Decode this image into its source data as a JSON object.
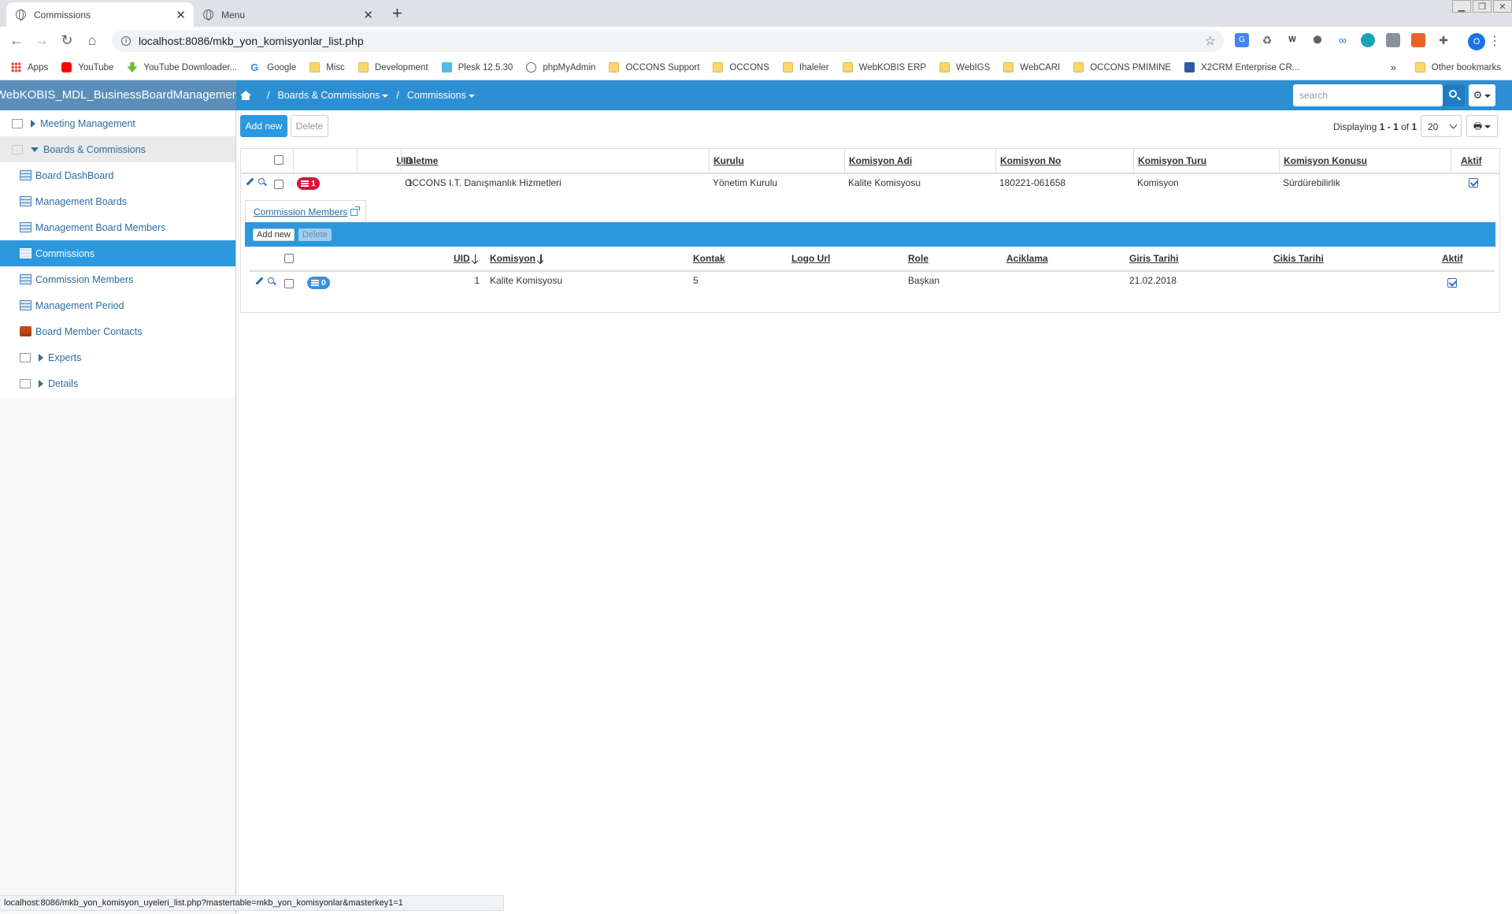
{
  "browser": {
    "tabs": [
      {
        "title": "Commissions",
        "active": true
      },
      {
        "title": "Menu",
        "active": false
      }
    ],
    "url": "localhost:8086/mkb_yon_komisyonlar_list.php",
    "bookmarks": [
      {
        "label": "Apps",
        "icon": "apps-icon"
      },
      {
        "label": "YouTube",
        "icon": "youtube-icon"
      },
      {
        "label": "YouTube Downloader...",
        "icon": "download-icon"
      },
      {
        "label": "Google",
        "icon": "google-icon"
      },
      {
        "label": "Misc",
        "icon": "folder-icon"
      },
      {
        "label": "Development",
        "icon": "folder-icon"
      },
      {
        "label": "Plesk 12.5.30",
        "icon": "plesk-icon"
      },
      {
        "label": "phpMyAdmin",
        "icon": "globe-icon"
      },
      {
        "label": "OCCONS Support",
        "icon": "folder-icon"
      },
      {
        "label": "OCCONS",
        "icon": "folder-icon"
      },
      {
        "label": "Ihaleler",
        "icon": "folder-icon"
      },
      {
        "label": "WebKOBIS ERP",
        "icon": "folder-icon"
      },
      {
        "label": "WebIGS",
        "icon": "folder-icon"
      },
      {
        "label": "WebCARI",
        "icon": "folder-icon"
      },
      {
        "label": "OCCONS PMIMINE",
        "icon": "folder-icon"
      },
      {
        "label": "X2CRM Enterprise CR...",
        "icon": "x2crm-icon"
      }
    ],
    "more_bookmarks": "»",
    "other_bookmarks": "Other bookmarks",
    "profile_initial": "O",
    "status_url": "localhost:8086/mkb_yon_komisyon_uyeleri_list.php?mastertable=mkb_yon_komisyonlar&masterkey1=1"
  },
  "app": {
    "brand": "WebKOBIS_MDL_BusinessBoardManagement",
    "breadcrumb": [
      {
        "label": "Boards & Commissions"
      },
      {
        "label": "Commissions"
      }
    ],
    "search_placeholder": "search",
    "accent_color": "#2c98de"
  },
  "sidebar": {
    "items": [
      {
        "label": "Meeting Management",
        "type": "group-collapsed"
      },
      {
        "label": "Boards & Commissions",
        "type": "group-expanded"
      },
      {
        "label": "Board DashBoard",
        "type": "link"
      },
      {
        "label": "Management Boards",
        "type": "link"
      },
      {
        "label": "Management Board Members",
        "type": "link"
      },
      {
        "label": "Commissions",
        "type": "link",
        "active": true
      },
      {
        "label": "Commission Members",
        "type": "link"
      },
      {
        "label": "Management Period",
        "type": "link"
      },
      {
        "label": "Board Member Contacts",
        "type": "link"
      },
      {
        "label": "Experts",
        "type": "group-collapsed"
      },
      {
        "label": "Details",
        "type": "group-collapsed"
      }
    ]
  },
  "main": {
    "add_label": "Add new",
    "delete_label": "Delete",
    "displaying_prefix": "Displaying",
    "displaying_from": "1",
    "displaying_dash": "-",
    "displaying_to": "1",
    "displaying_of": "of",
    "displaying_total": "1",
    "page_size": "20",
    "columns": [
      "UID",
      "Isletme",
      "Kurulu",
      "Komisyon Adi",
      "Komisyon No",
      "Komisyon Turu",
      "Komisyon Konusu",
      "Aktif"
    ],
    "rows": [
      {
        "details_count": "1",
        "uid": "1",
        "isletme": "OCCONS I.T. Danışmanlık Hizmetleri",
        "kurulu": "Yönetim Kurulu",
        "komisyon_adi": "Kalite Komisyosu",
        "komisyon_no": "180221-061658",
        "komisyon_turu": "Komisyon",
        "komisyon_konusu": "Sürdürebilirlik",
        "aktif": true
      }
    ],
    "detail": {
      "tab_label": "Commission Members",
      "add_label": "Add new",
      "delete_label": "Delete",
      "columns": [
        "UID",
        "Komisyon",
        "Kontak",
        "Logo Url",
        "Role",
        "Aciklama",
        "Giris Tarihi",
        "Cikis Tarihi",
        "Aktif"
      ],
      "rows": [
        {
          "details_count": "0",
          "uid": "1",
          "komisyon": "Kalite Komisyosu",
          "kontak": "5",
          "logo_url": "",
          "role": "Başkan",
          "aciklama": "",
          "giris_tarihi": "21.02.2018",
          "cikis_tarihi": "",
          "aktif": true
        }
      ]
    }
  }
}
